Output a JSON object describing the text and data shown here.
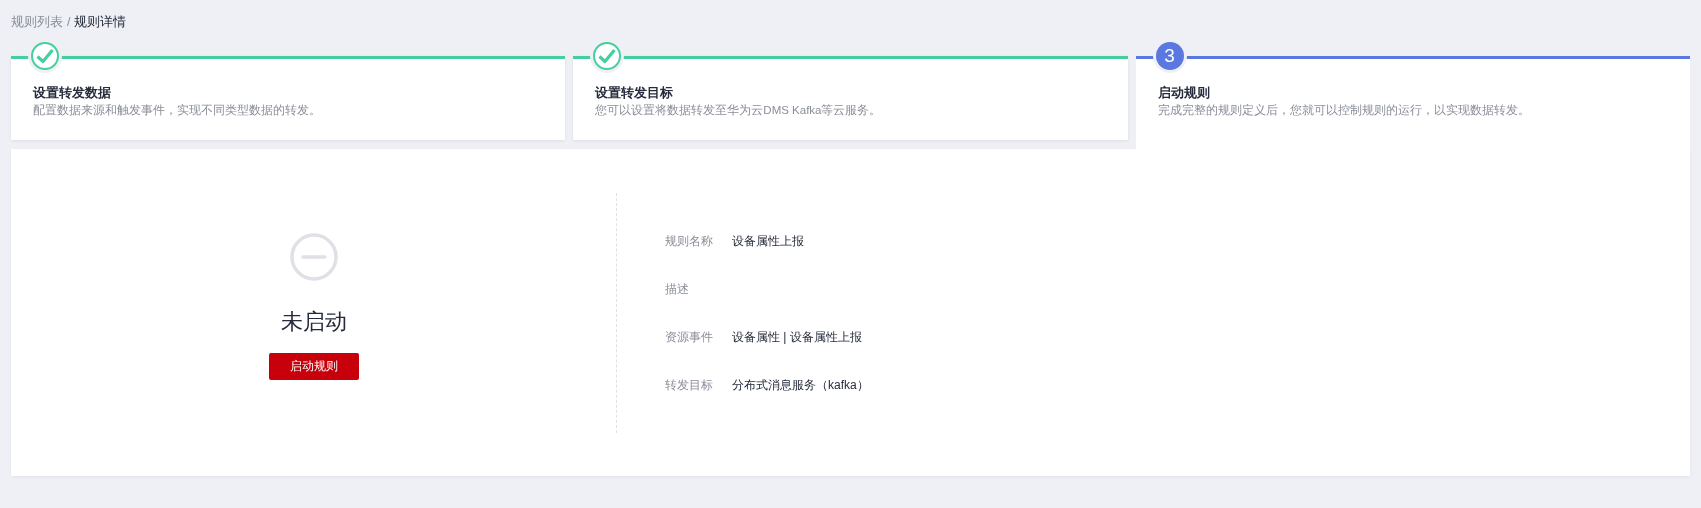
{
  "breadcrumb": [
    {
      "label": "规则列表",
      "current": false
    },
    {
      "label": "规则详情",
      "current": true
    }
  ],
  "breadcrumb_separator": "/",
  "steps": [
    {
      "completed": true,
      "current": false,
      "title": "设置转发数据",
      "description": "配置数据来源和触发事件，实现不同类型数据的转发。"
    },
    {
      "completed": true,
      "current": false,
      "title": "设置转发目标",
      "description": "您可以设置将数据转发至华为云DMS Kafka等云服务。"
    },
    {
      "completed": false,
      "current": true,
      "number": "3",
      "title": "启动规则",
      "description": "完成完整的规则定义后，您就可以控制规则的运行，以实现数据转发。"
    }
  ],
  "rule_status": {
    "running": false,
    "label": "未启动",
    "button": "启动规则"
  },
  "details": [
    {
      "label": "规则名称",
      "value": "设备属性上报"
    },
    {
      "label": "描述"
    },
    {
      "label": "资源事件",
      "value": "设备属性 | 设备属性上报"
    },
    {
      "label": "转发目标",
      "value": "分布式消息服务（kafka）"
    }
  ]
}
